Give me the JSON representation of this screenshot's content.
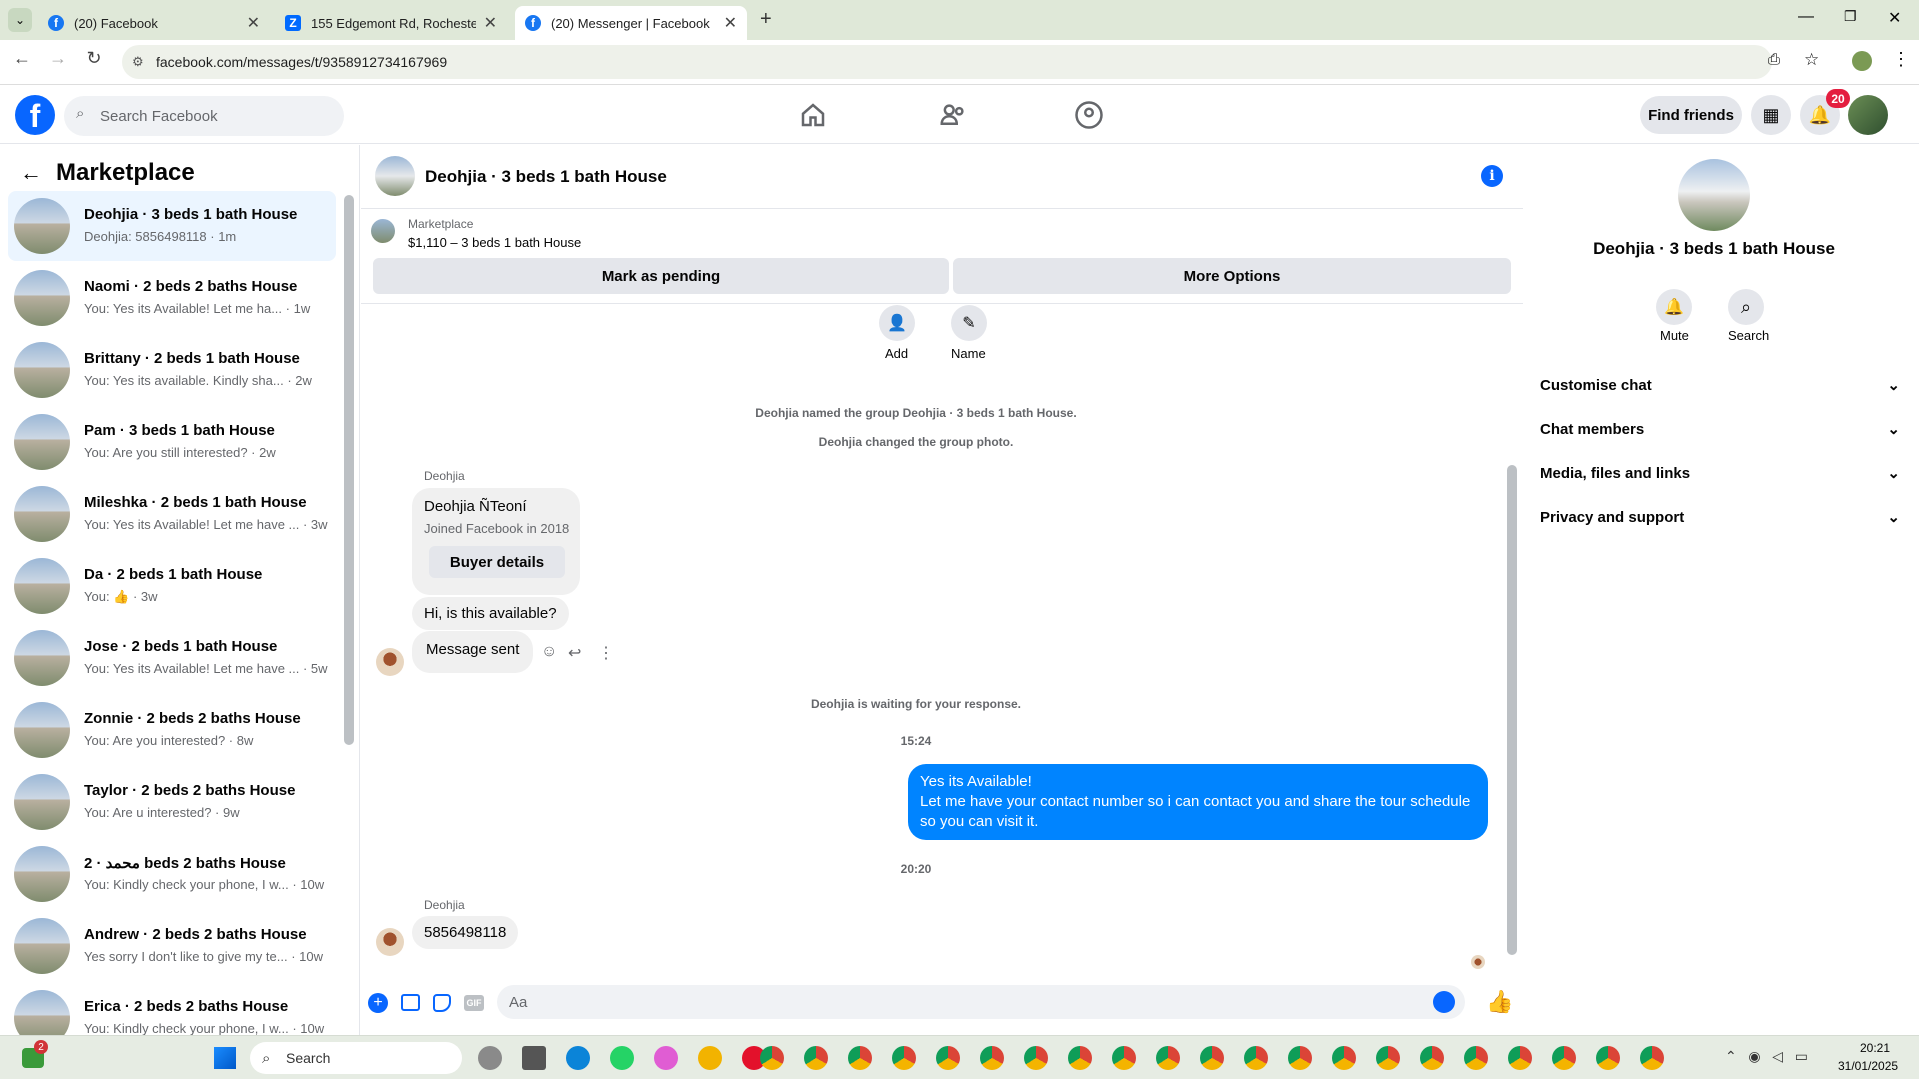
{
  "browser": {
    "tabs": [
      {
        "label": "(20) Facebook"
      },
      {
        "label": "155 Edgemont Rd, Rochester, N"
      },
      {
        "label": "(20) Messenger | Facebook"
      }
    ],
    "url": "facebook.com/messages/t/9358912734167969"
  },
  "fb": {
    "search_placeholder": "Search Facebook",
    "find_friends": "Find friends",
    "notif_count": "20"
  },
  "left": {
    "title": "Marketplace",
    "conversations": [
      {
        "title": "Deohjia · 3 beds 1 bath House",
        "sub": "Deohjia: 5856498118 · 1m"
      },
      {
        "title": "Naomi · 2 beds 2 baths House",
        "sub": "You: Yes its Available! Let me ha... · 1w"
      },
      {
        "title": "Brittany · 2 beds 1 bath House",
        "sub": "You: Yes its available. Kindly sha... · 2w"
      },
      {
        "title": "Pam · 3 beds 1 bath House",
        "sub": "You: Are you still interested? · 2w"
      },
      {
        "title": "Mileshka · 2 beds 1 bath House",
        "sub": "You: Yes its Available! Let me have ... · 3w"
      },
      {
        "title": "Da · 2 beds 1 bath House",
        "sub": "You: 👍 · 3w"
      },
      {
        "title": "Jose · 2 beds 1 bath House",
        "sub": "You: Yes its Available! Let me have ... · 5w"
      },
      {
        "title": "Zonnie · 2 beds 2 baths House",
        "sub": "You: Are you interested? · 8w"
      },
      {
        "title": "Taylor · 2 beds 2 baths House",
        "sub": "You: Are u interested? · 9w"
      },
      {
        "title": "محمد · 2 beds 2 baths House",
        "sub": "You: Kindly check your phone, I w... · 10w"
      },
      {
        "title": "Andrew · 2 beds 2 baths House",
        "sub": "Yes sorry I don't like to give my te... · 10w"
      },
      {
        "title": "Erica · 2 beds 2 baths House",
        "sub": "You: Kindly check your phone, I w... · 10w"
      }
    ]
  },
  "chat": {
    "title": "Deohjia · 3 beds 1 bath House",
    "listing_source": "Marketplace",
    "listing_desc": "$1,110 – 3 beds 1 bath House",
    "mark_pending": "Mark as pending",
    "more_options": "More Options",
    "add_label": "Add",
    "name_label": "Name",
    "sys1": "Deohjia named the group Deohjia · 3 beds 1 bath House.",
    "sys2": "Deohjia changed the group photo.",
    "sender1": "Deohjia",
    "card_name": "Deohjia ÑTeoní",
    "card_joined": "Joined Facebook in 2018",
    "buyer_details": "Buyer details",
    "msg_available": "Hi, is this available?",
    "msg_sent": "Message sent",
    "sys3": "Deohjia is waiting for your response.",
    "time1": "15:24",
    "my_msg_line1": "Yes its Available!",
    "my_msg_line2": "Let me have your contact number so i can contact you and share the tour schedule",
    "my_msg_line3": "so you can visit it.",
    "time2": "20:20",
    "sender2": "Deohjia",
    "msg_phone": "5856498118",
    "input_placeholder": "Aa"
  },
  "right": {
    "title": "Deohjia · 3 beds 1 bath House",
    "mute": "Mute",
    "search": "Search",
    "items": [
      "Customise chat",
      "Chat members",
      "Media, files and links",
      "Privacy and support"
    ]
  },
  "taskbar": {
    "search": "Search",
    "badge": "2",
    "time": "20:21",
    "date": "31/01/2025"
  },
  "colors": {
    "fb_blue": "#0866ff",
    "bubble_blue": "#0084ff",
    "active_conv": "#ebf5ff"
  }
}
